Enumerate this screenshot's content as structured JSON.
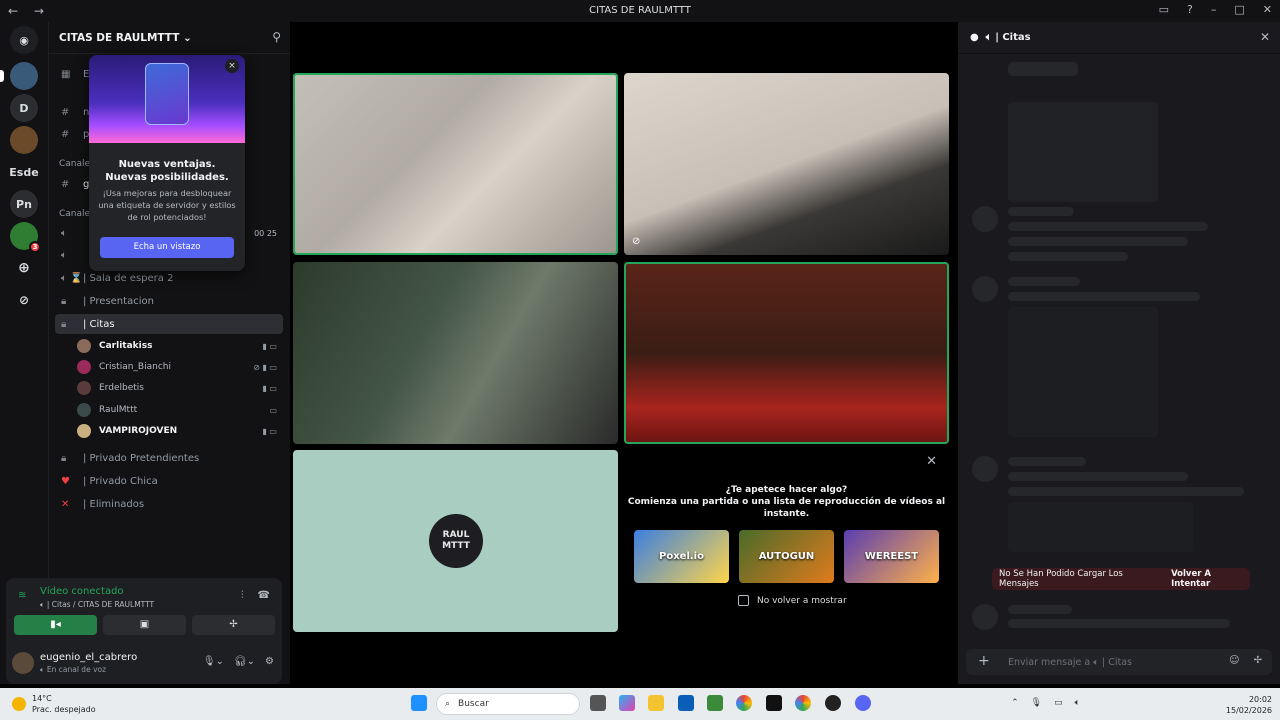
{
  "window": {
    "title": "CITAS DE RAULMTTT"
  },
  "servers": [
    {
      "label": "D"
    },
    {
      "label": "Esde"
    },
    {
      "label": "Pn"
    },
    {
      "label": "3"
    }
  ],
  "sidebar": {
    "server_name": "CITAS DE RAULMTTT",
    "top_items": [
      {
        "label": "Ev"
      },
      {
        "label": "no"
      },
      {
        "label": "pr"
      }
    ],
    "category_1": "Canale",
    "text_channel": "ge",
    "category_2": "Canale",
    "voice_counter": "00 25",
    "channels": [
      {
        "label": "| Sala de espera 2"
      },
      {
        "label": "| Presentacion"
      },
      {
        "label": "| Citas"
      },
      {
        "label": "| Privado Pretendientes"
      },
      {
        "label": "| Privado Chica"
      },
      {
        "label": "| Eliminados"
      }
    ],
    "voice_users": [
      {
        "name": "Carlitakiss"
      },
      {
        "name": "Cristian_Bianchi"
      },
      {
        "name": "Erdelbetis"
      },
      {
        "name": "RaulMttt"
      },
      {
        "name": "VAMPIROJOVEN"
      }
    ]
  },
  "popup": {
    "title": "Nuevas ventajas. Nuevas posibilidades.",
    "description": "¡Usa mejoras para desbloquear una etiqueta de servidor y estilos de rol potenciados!",
    "button": "Echa un vistazo",
    "close": "×"
  },
  "voice_panel": {
    "status": "Vídeo conectado",
    "location": "| Citas / CITAS DE RAULMTTT"
  },
  "user": {
    "name": "eugenio_el_cabrero",
    "status": "En canal de voz"
  },
  "stage": {
    "placeholder_logo": "RAUL MTTT",
    "activity": {
      "question": "¿Te apetece hacer algo?",
      "subtitle": "Comienza una partida o una lista de reproducción de vídeos al instante.",
      "games": [
        "Poxel.io",
        "AUTOGUN",
        "WEREEST"
      ],
      "checkbox_label": "No volver a mostrar"
    }
  },
  "chat": {
    "title": "| Citas",
    "error": "No Se Han Podido Cargar Los Mensajes",
    "retry": "Volver A Intentar",
    "input_placeholder": "Enviar mensaje a",
    "input_channel": "| Citas"
  },
  "taskbar": {
    "temp": "14°C",
    "weather": "Prac. despejado",
    "search": "Buscar",
    "time": "20:02",
    "date": "15/02/2026"
  },
  "colors": {
    "accent": "#5865f2",
    "speaking": "#23a55a",
    "danger": "#f23f43"
  }
}
